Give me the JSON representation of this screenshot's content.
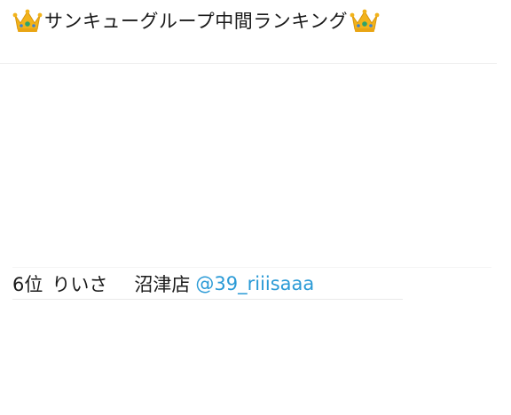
{
  "post": {
    "title_icon_left": "crown-icon",
    "title": "サンキューグループ中間ランキング",
    "title_icon_right": "crown-icon"
  },
  "ranking_entry": {
    "rank": "6位",
    "name": "りいさ",
    "store": "沼津店",
    "handle": "@39_riiisaaa"
  },
  "colors": {
    "link": "#2a9ad6",
    "crown_gold": "#f2b31b",
    "crown_gem": "#2fa36b"
  }
}
